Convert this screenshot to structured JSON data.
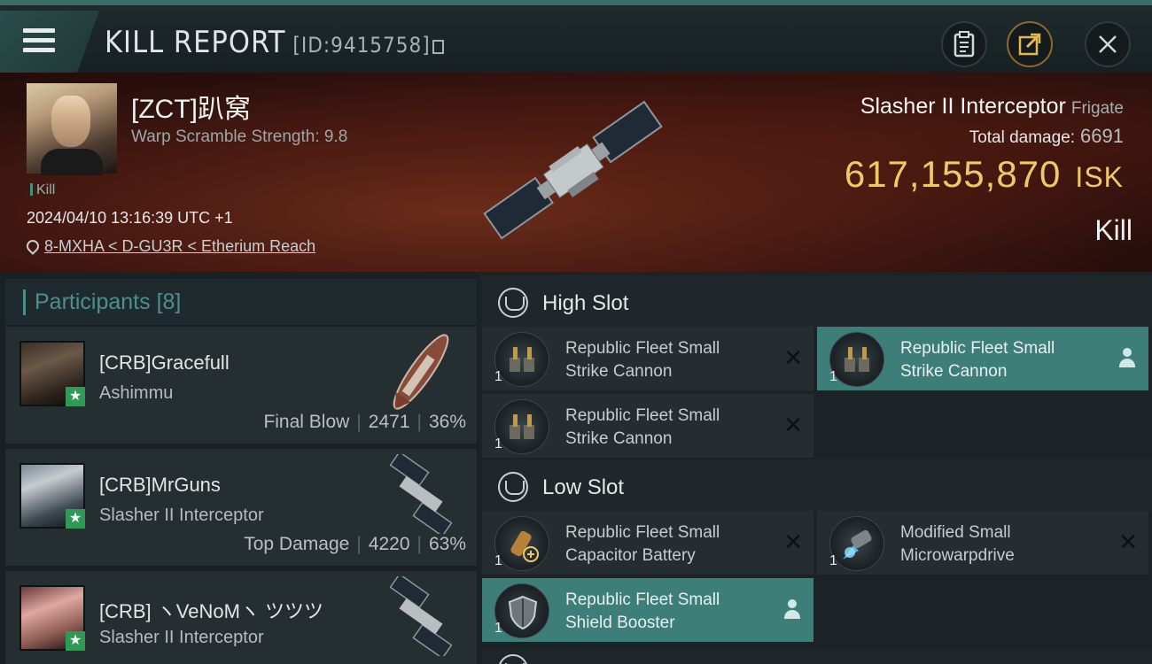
{
  "header": {
    "title": "KILL REPORT",
    "id_label": "[ID:9415758]"
  },
  "victim": {
    "name": "[ZCT]趴窝",
    "warp_scramble": "Warp Scramble Strength: 9.8",
    "kill_tag": "Kill",
    "datetime": "2024/04/10 13:16:39 UTC +1",
    "location": "8-MXHA < D-GU3R < Etherium Reach",
    "ship_name": "Slasher II Interceptor",
    "ship_class": "Frigate",
    "total_damage_label": "Total damage:",
    "total_damage": "6691",
    "isk_value": "617,155,870",
    "isk_unit": "ISK",
    "result": "Kill"
  },
  "participants": {
    "title": "Participants",
    "count": "[8]",
    "items": [
      {
        "name": "[CRB]Gracefull",
        "ship": "Ashimmu",
        "role": "Final Blow",
        "damage": "2471",
        "percent": "36%"
      },
      {
        "name": "[CRB]MrGuns",
        "ship": "Slasher II Interceptor",
        "role": "Top Damage",
        "damage": "4220",
        "percent": "63%"
      },
      {
        "name": "[CRB] ヽVeNoMヽ ツツツ",
        "ship": "Slasher II Interceptor",
        "role": "",
        "damage": "",
        "percent": ""
      }
    ]
  },
  "fittings": {
    "high_slot_label": "High Slot",
    "low_slot_label": "Low Slot",
    "high": [
      {
        "qty": "1",
        "name_line1": "Republic Fleet Small",
        "name_line2": "Strike Cannon",
        "state": "destroyed"
      },
      {
        "qty": "1",
        "name_line1": "Republic Fleet Small",
        "name_line2": "Strike Cannon",
        "state": "dropped"
      },
      {
        "qty": "1",
        "name_line1": "Republic Fleet Small",
        "name_line2": "Strike Cannon",
        "state": "destroyed"
      }
    ],
    "low": [
      {
        "qty": "1",
        "name_line1": "Republic Fleet Small",
        "name_line2": "Capacitor Battery",
        "state": "destroyed"
      },
      {
        "qty": "1",
        "name_line1": "Modified Small",
        "name_line2": "Microwarpdrive",
        "state": "destroyed"
      },
      {
        "qty": "1",
        "name_line1": "Republic Fleet Small",
        "name_line2": "Shield Booster",
        "state": "dropped"
      }
    ]
  },
  "colors": {
    "accent": "#3e7e78",
    "isk": "#f0c865",
    "banner": "#4b1b12"
  }
}
